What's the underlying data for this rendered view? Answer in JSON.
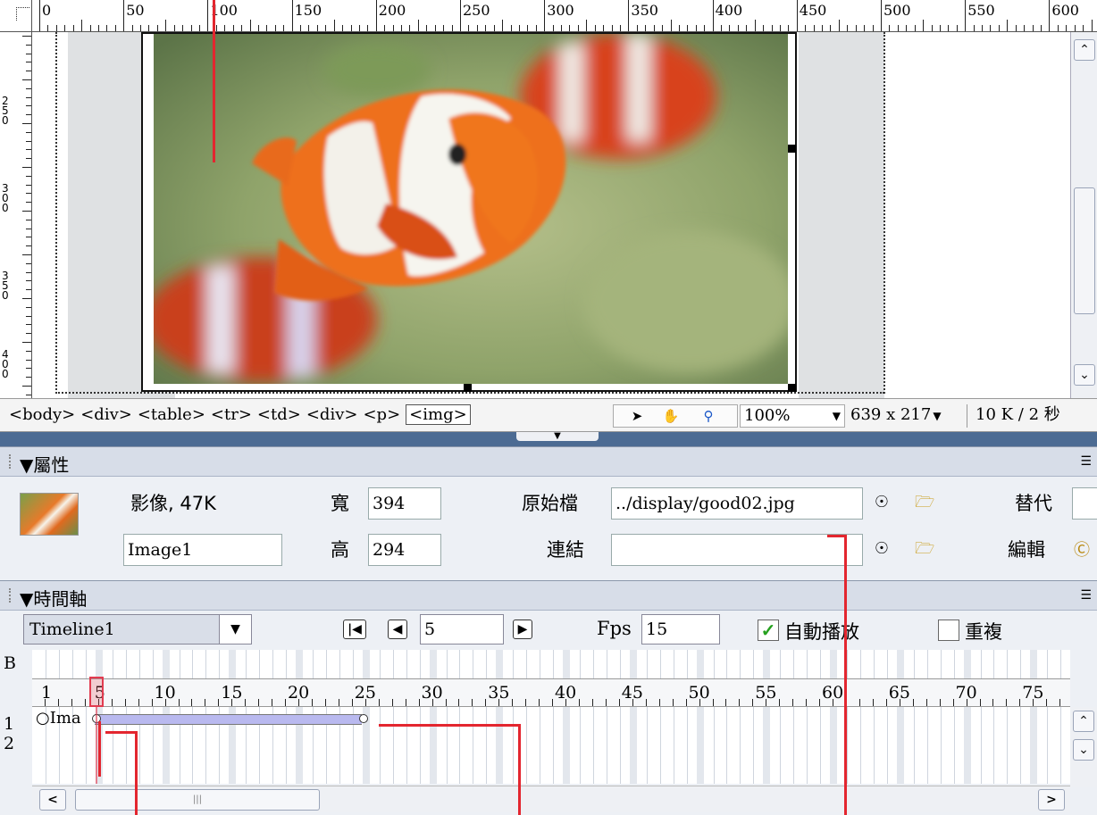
{
  "ruler": {
    "h_labels": [
      "0",
      "50",
      "100",
      "150",
      "200",
      "250",
      "300",
      "350",
      "400",
      "450",
      "500",
      "550",
      "600"
    ],
    "v_labels": [
      "250",
      "300",
      "350",
      "400"
    ]
  },
  "statusbar": {
    "tags": [
      "<body>",
      "<div>",
      "<table>",
      "<tr>",
      "<td>",
      "<div>",
      "<p>",
      "<img>"
    ],
    "zoom": "100%",
    "dimensions": "639 x 217",
    "size": "10 K / 2 秒"
  },
  "properties": {
    "title": "屬性",
    "type_label": "影像, 47K",
    "image_name": "Image1",
    "width_label": "寬",
    "width_value": "394",
    "height_label": "高",
    "height_value": "294",
    "src_label": "原始檔",
    "src_value": "../display/good02.jpg",
    "link_label": "連結",
    "link_value": "",
    "alt_label": "替代",
    "edit_label": "編輯"
  },
  "timeline": {
    "title": "時間軸",
    "name": "Timeline1",
    "frame": "5",
    "fps_label": "Fps",
    "fps_value": "15",
    "autoplay_label": "自動播放",
    "autoplay_checked": true,
    "loop_label": "重複",
    "loop_checked": false,
    "behavior_row": "B",
    "ticks": [
      "1",
      "5",
      "10",
      "15",
      "20",
      "25",
      "30",
      "35",
      "40",
      "45",
      "50",
      "55",
      "60",
      "65",
      "70",
      "75"
    ],
    "rows": [
      "1",
      "2"
    ],
    "sprite_label": "Ima",
    "sprite_start": 5,
    "sprite_end": 25
  },
  "colors": {
    "annotation": "#e3262f",
    "sprite_bar": "#b9b9ef",
    "panel_header": "#d7dde8",
    "splitter": "#4c6b93"
  }
}
